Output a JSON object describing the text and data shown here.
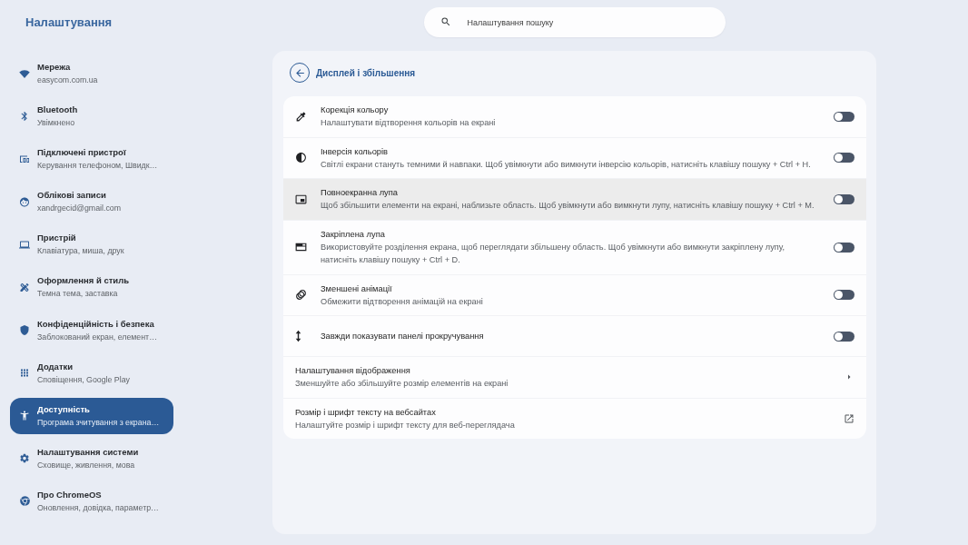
{
  "app_title": "Налаштування",
  "search": {
    "placeholder": "Налаштування пошуку"
  },
  "sidebar": {
    "items": [
      {
        "title": "Мережа",
        "subtitle": "easycom.com.ua",
        "selected": false
      },
      {
        "title": "Bluetooth",
        "subtitle": "Увімкнено",
        "selected": false
      },
      {
        "title": "Підключені пристрої",
        "subtitle": "Керування телефоном, Швидк…",
        "selected": false
      },
      {
        "title": "Облікові записи",
        "subtitle": "xandrgecid@gmail.com",
        "selected": false
      },
      {
        "title": "Пристрій",
        "subtitle": "Клавіатура, миша, друк",
        "selected": false
      },
      {
        "title": "Оформлення й стиль",
        "subtitle": "Темна тема, заставка",
        "selected": false
      },
      {
        "title": "Конфіденційність і безпека",
        "subtitle": "Заблокований екран, елемент…",
        "selected": false
      },
      {
        "title": "Додатки",
        "subtitle": "Сповіщення, Google Play",
        "selected": false
      },
      {
        "title": "Доступність",
        "subtitle": "Програма зчитування з екрана…",
        "selected": true
      },
      {
        "title": "Налаштування системи",
        "subtitle": "Сховище, живлення, мова",
        "selected": false
      },
      {
        "title": "Про ChromeOS",
        "subtitle": "Оновлення, довідка, параметр…",
        "selected": false
      }
    ]
  },
  "page": {
    "title": "Дисплей і збільшення",
    "rows": [
      {
        "kind": "toggle",
        "title": "Корекція кольору",
        "description": "Налаштувати відтворення кольорів на екрані",
        "on": false,
        "highlighted": false
      },
      {
        "kind": "toggle",
        "title": "Інверсія кольорів",
        "description": "Світлі екрани стануть темними й навпаки. Щоб увімкнути або вимкнути інверсію кольорів, натисніть клавішу пошуку + Ctrl + H.",
        "on": false,
        "highlighted": false
      },
      {
        "kind": "toggle",
        "title": "Повноекранна лупа",
        "description": "Щоб збільшити елементи на екрані, наблизьте область. Щоб увімкнути або вимкнути лупу, натисніть клавішу пошуку + Ctrl + M.",
        "on": false,
        "highlighted": true
      },
      {
        "kind": "toggle",
        "title": "Закріплена лупа",
        "description": "Використовуйте розділення екрана, щоб переглядати збільшену область. Щоб увімкнути або вимкнути закріплену лупу, натисніть клавішу пошуку + Ctrl + D.",
        "on": false,
        "highlighted": false
      },
      {
        "kind": "toggle",
        "title": "Зменшені анімації",
        "description": "Обмежити відтворення анімацій на екрані",
        "on": false,
        "highlighted": false
      },
      {
        "kind": "toggle",
        "title": "Завжди показувати панелі прокручування",
        "on": false,
        "highlighted": false
      },
      {
        "kind": "subpage",
        "title": "Налаштування відображення",
        "description": "Зменшуйте або збільшуйте розмір елементів на екрані",
        "highlighted": false
      },
      {
        "kind": "external",
        "title": "Розмір і шрифт тексту на вебсайтах",
        "description": "Налаштуйте розмір і шрифт тексту для веб-переглядача",
        "highlighted": false
      }
    ]
  }
}
